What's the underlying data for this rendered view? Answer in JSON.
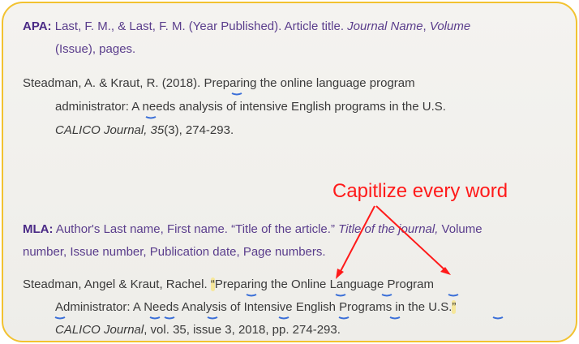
{
  "apa": {
    "label": "APA:",
    "format_line1": " Last, F. M., & Last, F. M. (Year Published). Article title. ",
    "format_journal": "Journal Name",
    "format_comma": ", ",
    "format_volume": "Volume",
    "format_line2": "(Issue), pages.",
    "example_line1": "Steadman, A. & Kraut, R. (2018). Preparing the online language program",
    "example_line2": "administrator: A needs analysis of intensive English programs in the  U.S.",
    "example_journal": "CALICO Journal, 35",
    "example_tail": "(3), 274-293."
  },
  "annotation": {
    "text": "Capitlize every word",
    "color": "#ff1a1a"
  },
  "mla": {
    "label": "MLA:",
    "format_line1a": " Author's Last name, First name. “Title of the article.” ",
    "format_journal": "Title of the journal,",
    "format_line1b": " Volume",
    "format_line2": "number, Issue number, Publication date, Page numbers.",
    "example_line1a": "Steadman, Angel & Kraut, Rachel. ",
    "example_open_quote": "“",
    "example_line1b": "Preparing the Online Language Program",
    "example_line2a": "Administrator: A Needs Analysis of Intensive English Programs in the U.S.",
    "example_close_quote": "”",
    "example_journal": "CALICO Journal",
    "example_line3": ", vol. 35, issue 3, 2018, pp. 274-293."
  }
}
